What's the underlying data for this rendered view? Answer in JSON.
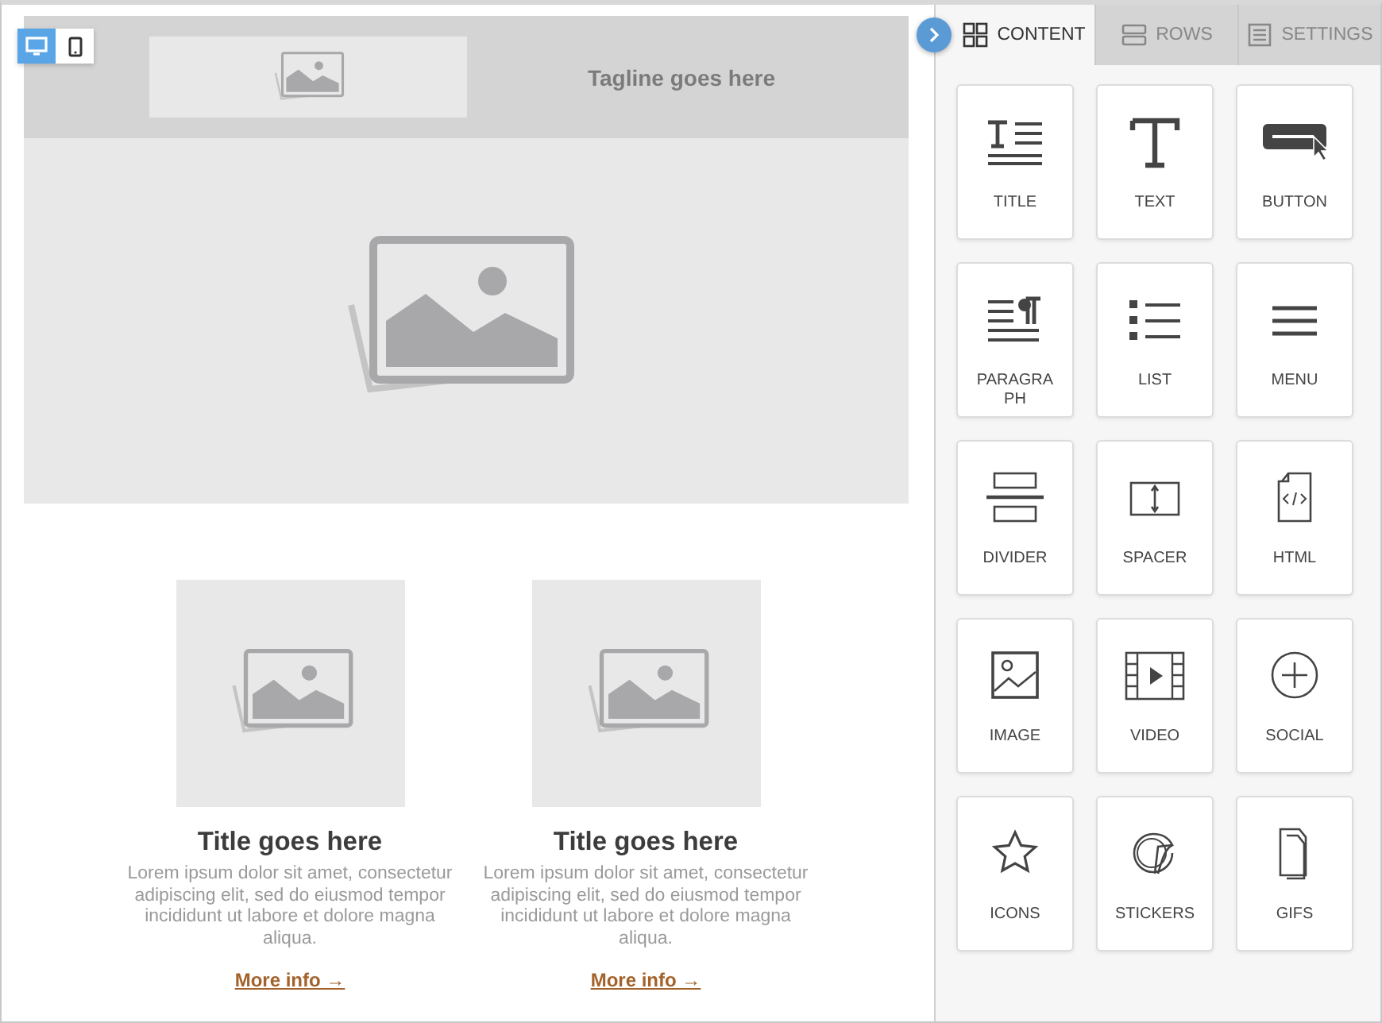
{
  "device_toggle": [
    {
      "kind": "desktop",
      "selected": true
    },
    {
      "kind": "mobile",
      "selected": false
    }
  ],
  "header": {
    "tagline": "Tagline goes here"
  },
  "columns": [
    {
      "title": "Title goes here",
      "body": "Lorem ipsum dolor sit amet, consectetur adipiscing elit, sed do eiusmod tempor incididunt ut labore et dolore magna aliqua.",
      "link": "More info →"
    },
    {
      "title": "Title goes here",
      "body": "Lorem ipsum dolor sit amet, consectetur adipiscing elit, sed do eiusmod tempor incididunt ut labore et dolore magna aliqua.",
      "link": "More info →"
    }
  ],
  "tabs": [
    {
      "label": "CONTENT",
      "kind": "content",
      "selected": true
    },
    {
      "label": "ROWS",
      "kind": "rows",
      "selected": false
    },
    {
      "label": "SETTINGS",
      "kind": "settings",
      "selected": false
    }
  ],
  "blocks": [
    {
      "label": "TITLE",
      "kind": "title"
    },
    {
      "label": "TEXT",
      "kind": "text"
    },
    {
      "label": "BUTTON",
      "kind": "button"
    },
    {
      "label": "PARAGRAPH",
      "kind": "paragraph"
    },
    {
      "label": "LIST",
      "kind": "list"
    },
    {
      "label": "MENU",
      "kind": "menu"
    },
    {
      "label": "DIVIDER",
      "kind": "divider"
    },
    {
      "label": "SPACER",
      "kind": "spacer"
    },
    {
      "label": "HTML",
      "kind": "html"
    },
    {
      "label": "IMAGE",
      "kind": "image"
    },
    {
      "label": "VIDEO",
      "kind": "video"
    },
    {
      "label": "SOCIAL",
      "kind": "social"
    },
    {
      "label": "ICONS",
      "kind": "icons"
    },
    {
      "label": "STICKERS",
      "kind": "stickers"
    },
    {
      "label": "GIFS",
      "kind": "gifs"
    }
  ]
}
